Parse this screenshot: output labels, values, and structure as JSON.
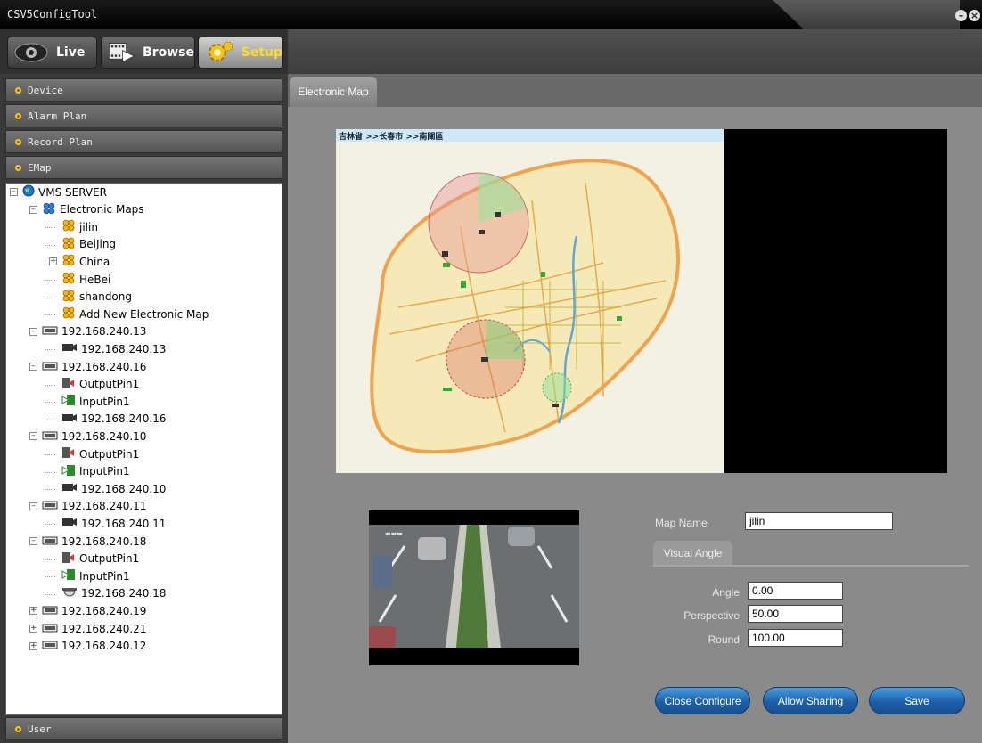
{
  "window": {
    "title": "CSV5ConfigTool",
    "minimize": "–",
    "close": "×"
  },
  "modes": [
    {
      "label": "Live",
      "icon": "eye-icon"
    },
    {
      "label": "Browse",
      "icon": "film-icon"
    },
    {
      "label": "Setup",
      "icon": "gear-icon",
      "active": true
    }
  ],
  "sidebar": {
    "sections": [
      "Device",
      "Alarm Plan",
      "Record Plan",
      "EMap"
    ],
    "bottom_section": "User"
  },
  "tree": {
    "root": "VMS SERVER",
    "maps_group": "Electronic Maps",
    "maps": [
      "jilin",
      "BeiJing",
      "China",
      "HeBei",
      "shandong",
      "Add New Electronic Map"
    ],
    "devices": [
      {
        "label": "192.168.240.13",
        "children": [
          "192.168.240.13"
        ]
      },
      {
        "label": "192.168.240.16",
        "children": [
          "OutputPin1",
          "InputPin1",
          "192.168.240.16"
        ]
      },
      {
        "label": "192.168.240.10",
        "children": [
          "OutputPin1",
          "InputPin1",
          "192.168.240.10"
        ]
      },
      {
        "label": "192.168.240.11",
        "children": [
          "192.168.240.11"
        ]
      },
      {
        "label": "192.168.240.18",
        "children": [
          "OutputPin1",
          "InputPin1",
          "192.168.240.18"
        ]
      },
      {
        "label": "192.168.240.19",
        "children": []
      },
      {
        "label": "192.168.240.21",
        "children": []
      },
      {
        "label": "192.168.240.12",
        "children": []
      }
    ]
  },
  "main": {
    "tab": "Electronic Map",
    "map_header": "吉林省 >>长春市 >>南關區",
    "map_name_label": "Map Name",
    "map_name": "jilin",
    "visual_angle_tab": "Visual Angle",
    "angle_label": "Angle",
    "angle": "0.00",
    "perspective_label": "Perspective",
    "perspective": "50.00",
    "round_label": "Round",
    "round": "100.00",
    "buttons": {
      "close": "Close Configure",
      "share": "Allow Sharing",
      "save": "Save"
    }
  },
  "colors": {
    "accent_yellow": "#ffcc00",
    "button_blue": "#1d5ea8"
  }
}
